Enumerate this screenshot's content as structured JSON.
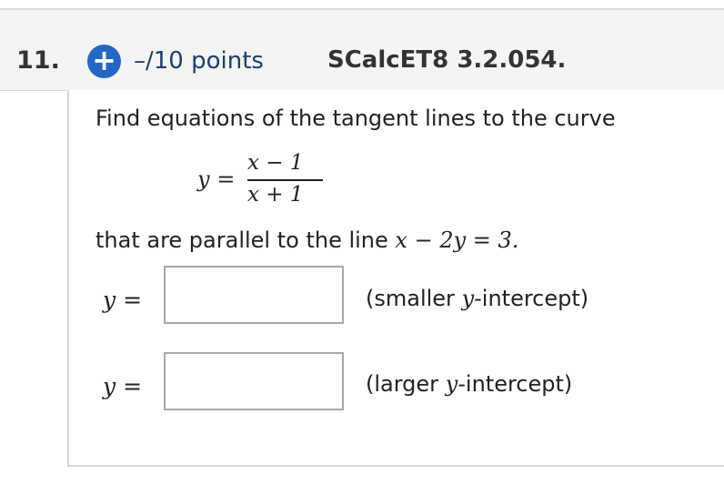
{
  "question": {
    "number": "11.",
    "plus_symbol": "+",
    "points": "–/10 points",
    "code": "SCalcET8 3.2.054."
  },
  "body": {
    "prompt": "Find equations of the tangent lines to the curve",
    "equation": {
      "lhs": "y =",
      "numerator": "x − 1",
      "denominator": "x + 1"
    },
    "parallel_text": "that are parallel to the line",
    "parallel_equation": "x − 2y = 3."
  },
  "answers": [
    {
      "label": "y =",
      "value": "",
      "note_prefix": "(smaller ",
      "note_var": "y",
      "note_suffix": "-intercept)"
    },
    {
      "label": "y =",
      "value": "",
      "note_prefix": "(larger ",
      "note_var": "y",
      "note_suffix": "-intercept)"
    }
  ],
  "colors": {
    "accent": "#2467c4",
    "header_bg": "#f4f4f4",
    "border": "#d6d6d6"
  },
  "icons": {
    "add": "plus-circle-icon"
  }
}
